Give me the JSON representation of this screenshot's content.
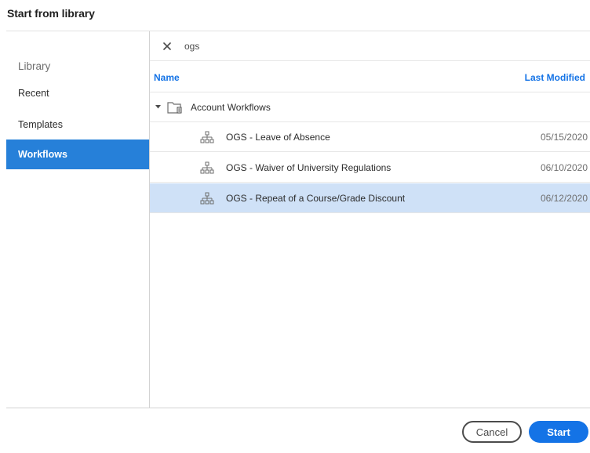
{
  "dialog": {
    "title": "Start from library"
  },
  "sidebar": {
    "heading": "Library",
    "items": [
      {
        "label": "Recent",
        "active": false
      },
      {
        "label": "Templates",
        "active": false
      },
      {
        "label": "Workflows",
        "active": true
      }
    ]
  },
  "search": {
    "value": "ogs",
    "clear_icon": "close-icon"
  },
  "table": {
    "columns": {
      "name": "Name",
      "last_modified": "Last Modified"
    },
    "folder": {
      "label": "Account Workflows",
      "icon": "folder-icon",
      "expanded": true
    },
    "rows": [
      {
        "name": "OGS - Leave of Absence",
        "date": "05/15/2020",
        "selected": false
      },
      {
        "name": "OGS - Waiver of University Regulations",
        "date": "06/10/2020",
        "selected": false
      },
      {
        "name": "OGS - Repeat of a Course/Grade Discount",
        "date": "06/12/2020",
        "selected": true
      }
    ],
    "row_icon": "workflow-icon"
  },
  "footer": {
    "cancel_label": "Cancel",
    "start_label": "Start"
  },
  "colors": {
    "accent": "#1473e6",
    "nav_active": "#2680d9",
    "row_selected": "#cfe1f7"
  }
}
